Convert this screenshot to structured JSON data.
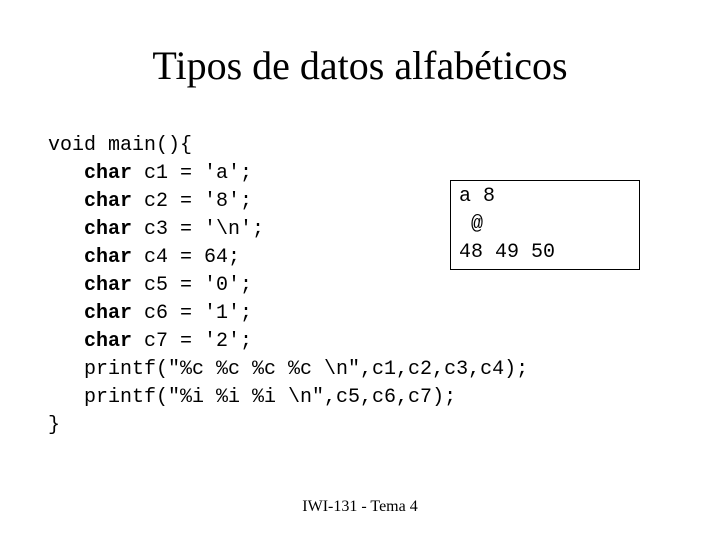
{
  "title": "Tipos de datos alfabéticos",
  "code": {
    "l1_a": "void main(){",
    "l2_b": "char",
    "l2_c": " c1 = 'a';",
    "l3_b": "char",
    "l3_c": " c2 = '8';",
    "l4_b": "char",
    "l4_c": " c3 = '\\n';",
    "l5_b": "char",
    "l5_c": " c4 = 64;",
    "l6_b": "char",
    "l6_c": " c5 = '0';",
    "l7_b": "char",
    "l7_c": " c6 = '1';",
    "l8_b": "char",
    "l8_c": " c7 = '2';",
    "l9": "   printf(\"%c %c %c %c \\n\",c1,c2,c3,c4);",
    "l10": "   printf(\"%i %i %i \\n\",c5,c6,c7);",
    "l11": "}"
  },
  "indent": "   ",
  "output": {
    "line1": "a 8",
    "line2": " @",
    "line3": "48 49 50"
  },
  "footer": "IWI-131 - Tema 4"
}
